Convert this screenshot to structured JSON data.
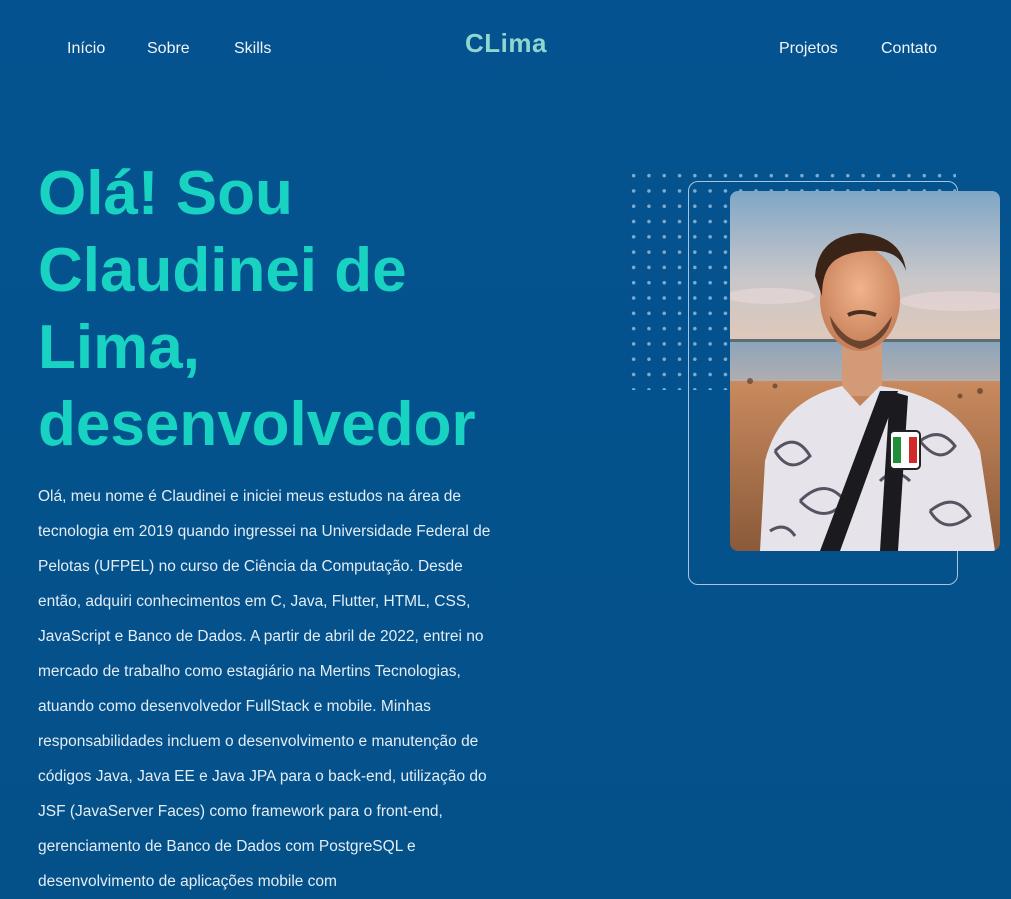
{
  "nav": {
    "left": [
      "Início",
      "Sobre",
      "Skills"
    ],
    "logo": "CLima",
    "right": [
      "Projetos",
      "Contato"
    ]
  },
  "hero": {
    "title": "Olá! Sou Claudinei de Lima, desenvolvedor",
    "paragraph": "Olá, meu nome é Claudinei e iniciei meus estudos na área de tecnologia em 2019 quando ingressei na Universidade Federal de Pelotas (UFPEL) no curso de Ciência da Computação. Desde então, adquiri conhecimentos em C, Java, Flutter, HTML, CSS, JavaScript e Banco de Dados. A partir de abril de 2022, entrei no mercado de trabalho como estagiário na Mertins Tecnologias, atuando como desenvolvedor FullStack e mobile. Minhas responsabilidades incluem o desenvolvimento e manutenção de códigos Java, Java EE e Java JPA para o back-end, utilização do JSF (JavaServer Faces) como framework para o front-end, gerenciamento de Banco de Dados com PostgreSQL e desenvolvimento de aplicações mobile com"
  },
  "colors": {
    "background": "#04528f",
    "accent": "#18d3c1",
    "logo": "#8fd6d0"
  }
}
